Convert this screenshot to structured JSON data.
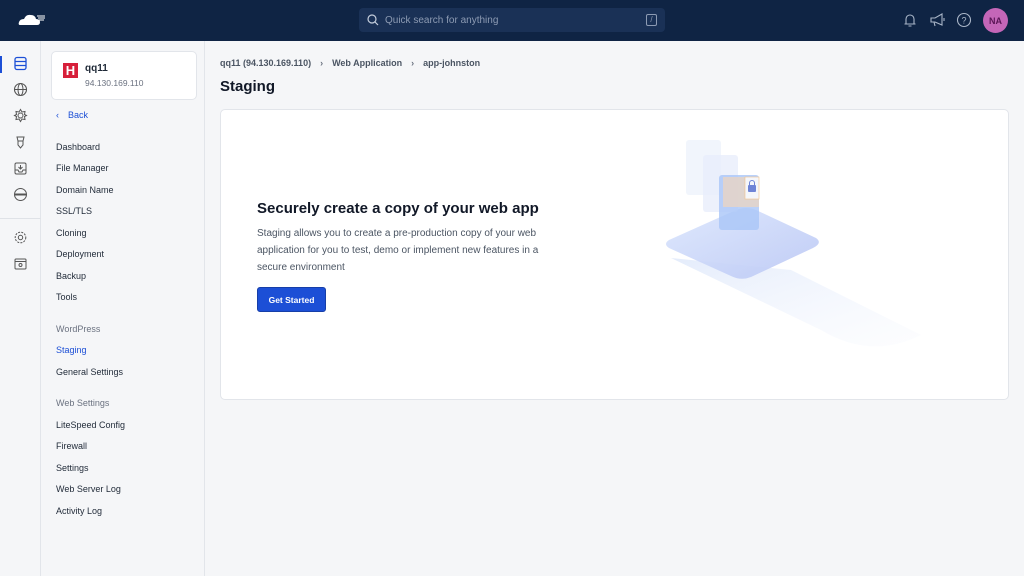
{
  "topbar": {
    "search_placeholder": "Quick search for anything",
    "search_shortcut": "/",
    "avatar_initials": "NA"
  },
  "server": {
    "name": "qq11",
    "ip": "94.130.169.110"
  },
  "sidebar": {
    "back": "Back",
    "items": [
      "Dashboard",
      "File Manager",
      "Domain Name",
      "SSL/TLS",
      "Cloning",
      "Deployment",
      "Backup",
      "Tools"
    ],
    "wordpress_heading": "WordPress",
    "wordpress_items": [
      "Staging",
      "General Settings"
    ],
    "web_heading": "Web Settings",
    "web_items": [
      "LiteSpeed Config",
      "Firewall",
      "Settings",
      "Web Server Log",
      "Activity Log"
    ]
  },
  "breadcrumb": [
    "qq11 (94.130.169.110)",
    "Web Application",
    "app-johnston"
  ],
  "page": {
    "title": "Staging",
    "heading": "Securely create a copy of your web app",
    "description": "Staging allows you to create a pre-production copy of your web application for you to test, demo or implement new features in a secure environment",
    "cta": "Get Started"
  },
  "colors": {
    "accent": "#1c4fd6",
    "topbar": "#0f2444"
  }
}
